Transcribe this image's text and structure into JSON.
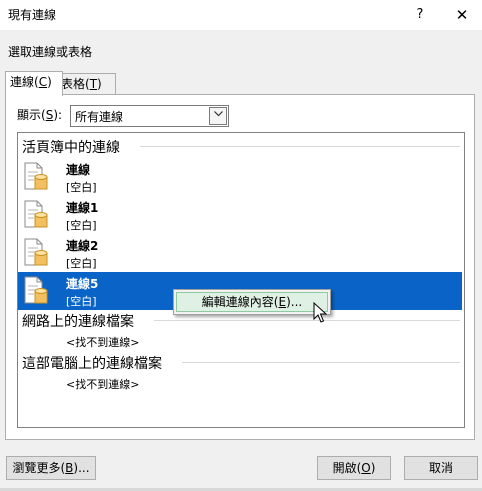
{
  "window": {
    "title": "現有連線",
    "help": "?",
    "close": "✕"
  },
  "prompt": "選取連線或表格",
  "tabs": [
    {
      "label": "連線",
      "key": "C",
      "active": true
    },
    {
      "label": "表格",
      "key": "T",
      "active": false
    }
  ],
  "show": {
    "label": "顯示",
    "key": "S",
    "colon": ":",
    "value": "所有連線"
  },
  "sections": {
    "workbook": "活頁簿中的連線",
    "network": "網路上的連線檔案",
    "computer": "這部電腦上的連線檔案"
  },
  "connections": [
    {
      "name": "連線",
      "desc": "[空白]"
    },
    {
      "name": "連線1",
      "desc": "[空白]"
    },
    {
      "name": "連線2",
      "desc": "[空白]"
    },
    {
      "name": "連線5",
      "desc": "[空白]",
      "selected": true
    }
  ],
  "not_found": {
    "network": "<找不到連線>",
    "computer": "<找不到連線>"
  },
  "context_menu": {
    "item_label": "編輯連線內容",
    "item_key": "E",
    "item_suffix": "..."
  },
  "buttons": {
    "browse": {
      "label": "瀏覽更多",
      "key": "B",
      "suffix": "..."
    },
    "open": {
      "label": "開啟",
      "key": "O"
    },
    "cancel": {
      "label": "取消"
    }
  },
  "colors": {
    "selection": "#0a64c8",
    "menu_highlight": "#dff0e4"
  }
}
